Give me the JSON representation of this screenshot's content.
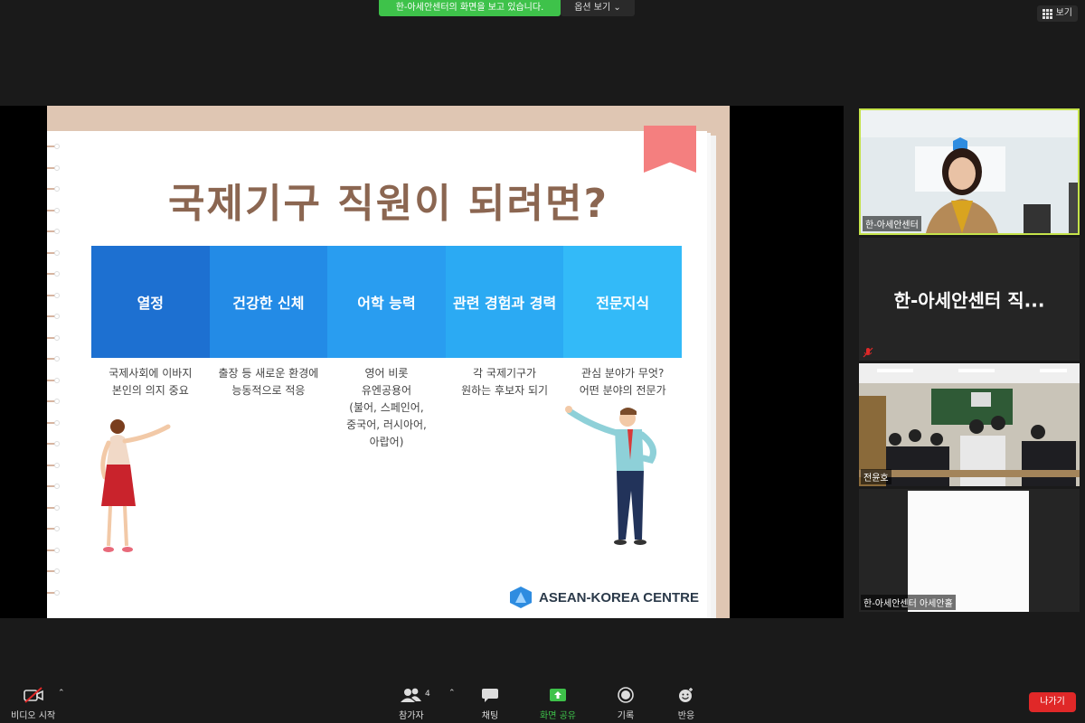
{
  "banner": {
    "sharing_text": "한-아세안센터의 화면을 보고 있습니다.",
    "options_label": "옵션 보기 ⌄",
    "view_label": "보기"
  },
  "slide": {
    "title": "국제기구 직원이 되려면?",
    "columns": [
      {
        "heading": "열정",
        "desc": [
          "국제사회에 이바지",
          "본인의 의지 중요"
        ]
      },
      {
        "heading": "건강한 신체",
        "desc": [
          "출장 등 새로운 환경에",
          "능동적으로 적응"
        ]
      },
      {
        "heading": "어학 능력",
        "desc": [
          "영어 비롯",
          "유엔공용어",
          "(불어, 스페인어,",
          "중국어, 러시아어,",
          "아랍어)"
        ]
      },
      {
        "heading": "관련 경험과 경력",
        "desc": [
          "각 국제기구가",
          "원하는 후보자 되기"
        ]
      },
      {
        "heading": "전문지식",
        "desc": [
          "관심 분야가 무엇?",
          "어떤 분야의 전문가"
        ]
      }
    ],
    "logo_text": "ASEAN-KOREA CENTRE"
  },
  "gallery": {
    "tiles": [
      {
        "label": "한-아세안센터"
      },
      {
        "label": "한-아세안센터 직..."
      },
      {
        "label": "전윤호"
      },
      {
        "label": "한-아세안센터 아세안홀"
      }
    ]
  },
  "toolbar": {
    "video_label": "비디오 시작",
    "participants_label": "참가자",
    "participants_count": "4",
    "chat_label": "채팅",
    "share_label": "화면 공유",
    "record_label": "기록",
    "reactions_label": "반응",
    "leave_label": "나가기"
  },
  "colors": {
    "accent_green": "#3ec24a",
    "active_speaker": "#c5e34a",
    "leave_red": "#e02828",
    "slide_title": "#8b6651"
  }
}
